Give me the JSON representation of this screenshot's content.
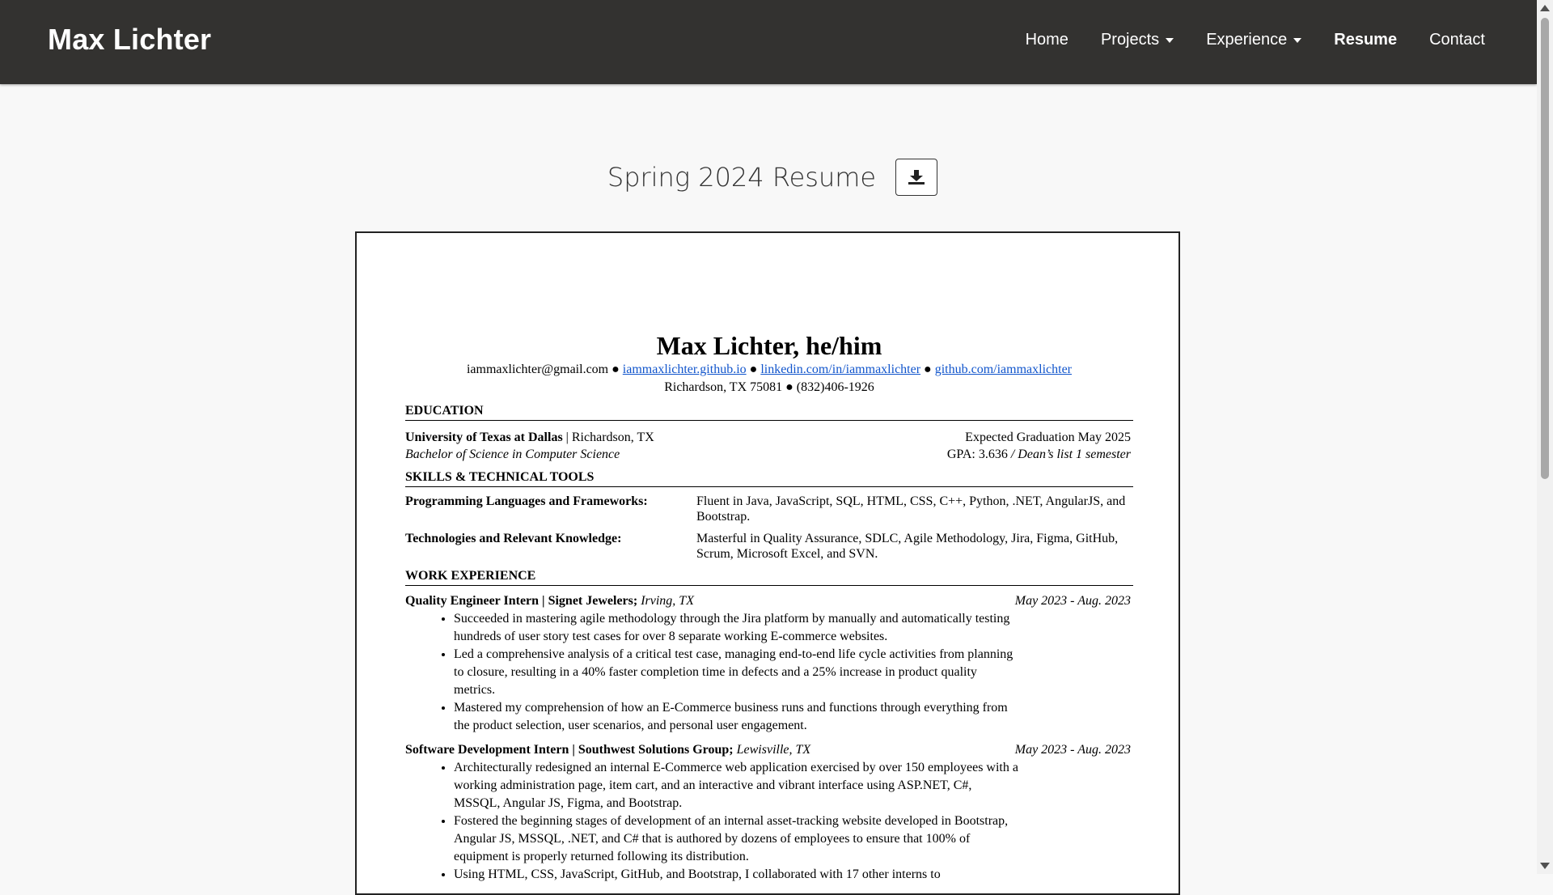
{
  "navbar": {
    "brand": "Max Lichter",
    "links": [
      "Home",
      "Projects",
      "Experience",
      "Resume",
      "Contact"
    ]
  },
  "page": {
    "title": "Spring 2024 Resume",
    "download_icon": "download-icon"
  },
  "resume": {
    "name": "Max Lichter, he/him",
    "email": "iammaxlichter@gmail.com",
    "sep": "●",
    "website": "iammaxlichter.github.io",
    "linkedin": "linkedin.com/in/iammaxlichter",
    "github": "github.com/iammaxlichter",
    "location": "Richardson, TX 75081",
    "phone": "(832)406-1926",
    "education": {
      "title": "EDUCATION",
      "school": "University of Texas at Dallas",
      "school_loc": "| Richardson, TX",
      "graduation": "Expected Graduation May 2025",
      "degree": "Bachelor of Science in Computer Science",
      "gpa": "GPA: 3.636",
      "deans": "/ Dean’s list 1 semester"
    },
    "skills": {
      "title": "SKILLS & TECHNICAL TOOLS",
      "items": [
        {
          "label": "Programming Languages and Frameworks:",
          "value": "Fluent in Java, JavaScript, SQL, HTML, CSS, C++, Python, .NET, AngularJS, and Bootstrap."
        },
        {
          "label": "Technologies and Relevant Knowledge:",
          "value": "Masterful in Quality Assurance, SDLC, Agile Methodology, Jira, Figma, GitHub, Scrum, Microsoft Excel, and SVN."
        }
      ]
    },
    "work": {
      "title": "WORK EXPERIENCE",
      "jobs": [
        {
          "role": "Quality Engineer Intern | Signet Jewelers;",
          "location": "Irving, TX",
          "dates": "May 2023 - Aug. 2023",
          "bullets": [
            "Succeeded in mastering agile methodology through the Jira platform by manually and automatically testing hundreds of user story test cases for over 8 separate working E-commerce websites.",
            "Led a comprehensive analysis of a critical test case, managing end-to-end life cycle activities from planning to closure, resulting in a 40% faster completion time in defects and a 25% increase in product quality metrics.",
            "Mastered my comprehension of how an E-Commerce business runs and functions through everything from the product selection, user scenarios, and personal user engagement."
          ]
        },
        {
          "role": "Software Development Intern | Southwest Solutions Group;",
          "location": "Lewisville, TX",
          "dates": "May 2023 - Aug. 2023",
          "bullets": [
            "Architecturally redesigned an internal E-Commerce web application exercised by over 150 employees with a working administration page, item cart, and an interactive and vibrant interface using ASP.NET, C#, MSSQL, Angular JS, Figma, and Bootstrap.",
            "Fostered the beginning stages of development of an internal asset-tracking website developed in Bootstrap, Angular JS, MSSQL, .NET, and C# that is authored by dozens of employees to ensure that 100% of equipment is properly returned following its distribution.",
            "Using HTML, CSS, JavaScript, GitHub, and Bootstrap, I collaborated with 17 other interns to"
          ]
        }
      ]
    }
  }
}
